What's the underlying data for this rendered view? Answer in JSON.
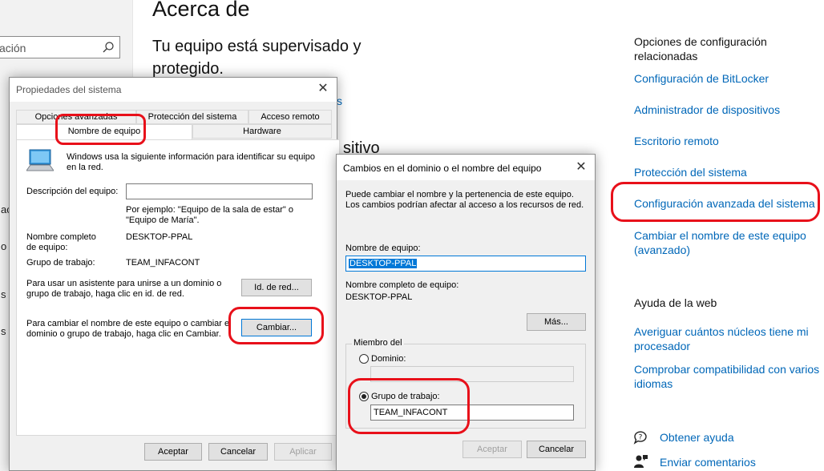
{
  "settings": {
    "search_fragment": "ación",
    "left_fragments": [
      "ac",
      "o",
      "s",
      "s"
    ],
    "title": "Acerca de",
    "status": "Tu equipo está supervisado y protegido.",
    "partial_link": "s",
    "partial_heading": "sitivo",
    "related_heading": "Opciones de configuración relacionadas",
    "links": [
      "Configuración de BitLocker",
      "Administrador de dispositivos",
      "Escritorio remoto",
      "Protección del sistema",
      "Configuración avanzada del sistema",
      "Cambiar el nombre de este equipo (avanzado)"
    ],
    "help_heading": "Ayuda de la web",
    "help_links": [
      "Averiguar cuántos núcleos tiene mi procesador",
      "Comprobar compatibilidad con varios idiomas"
    ],
    "get_help": "Obtener ayuda",
    "feedback": "Enviar comentarios"
  },
  "sys_props": {
    "title": "Propiedades del sistema",
    "tabs_row1": [
      "Opciones avanzadas",
      "Protección del sistema",
      "Acceso remoto"
    ],
    "tabs_row2": [
      "Nombre de equipo",
      "Hardware"
    ],
    "intro": "Windows usa la siguiente información para identificar su equipo en la red.",
    "desc_label": "Descripción del equipo:",
    "desc_value": "",
    "example": "Por ejemplo: \"Equipo de la sala de estar\" o \"Equipo de María\".",
    "fullname_label": "Nombre completo de equipo:",
    "fullname_value": "DESKTOP-PPAL",
    "workgroup_label": "Grupo de trabajo:",
    "workgroup_value": "TEAM_INFACONT",
    "netid_text": "Para usar un asistente para unirse a un dominio o grupo de trabajo, haga clic en id. de red.",
    "netid_button": "Id. de red...",
    "change_text": "Para cambiar el nombre de este equipo o cambiar el dominio o grupo de trabajo, haga clic en Cambiar.",
    "change_button": "Cambiar...",
    "ok": "Aceptar",
    "cancel": "Cancelar",
    "apply": "Aplicar"
  },
  "domain_dialog": {
    "title": "Cambios en el dominio o el nombre del equipo",
    "intro": "Puede cambiar el nombre y la pertenencia de este equipo. Los cambios podrían afectar al acceso a los recursos de red.",
    "name_label": "Nombre de equipo:",
    "name_value": "DESKTOP-PPAL",
    "fullname_label": "Nombre completo de equipo:",
    "fullname_value": "DESKTOP-PPAL",
    "more_button": "Más...",
    "member_of": "Miembro del",
    "domain_label": "Dominio:",
    "domain_value": "",
    "workgroup_label": "Grupo de trabajo:",
    "workgroup_value": "TEAM_INFACONT",
    "ok": "Aceptar",
    "cancel": "Cancelar"
  }
}
